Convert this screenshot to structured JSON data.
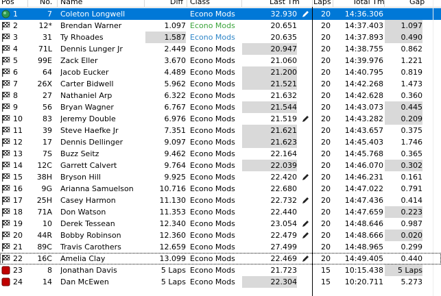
{
  "headers": {
    "pos": "Pos",
    "no": "No.",
    "name": "Name",
    "diff": "Diff",
    "class": "Class",
    "last_tm": "Last Tm",
    "laps": "Laps",
    "total_tm": "Total Tm",
    "gap": "Gap"
  },
  "colors": {
    "selected_bg": "#0078d7",
    "shade": "#d9d9d9",
    "green_text": "#3ba43b",
    "blue_text": "#2f86c8",
    "flag_green": "#2e9a52",
    "flag_stop": "#c00000"
  },
  "rows": [
    {
      "pos": "1",
      "no": "7",
      "name": "Coleton Longwell",
      "diff": "",
      "class": "Econo Mods",
      "last": "32.930",
      "laps": "20",
      "total": "14:36.306",
      "gap": "",
      "icon": "green-circle",
      "pencil": true,
      "selected": true
    },
    {
      "pos": "2",
      "no": "12*",
      "name": "Brendan Warner",
      "diff": "1.097",
      "class": "Econo Mods",
      "last": "20.651",
      "laps": "20",
      "total": "14:37.403",
      "gap": "1.097",
      "icon": "checkered-flag",
      "class_color": "green",
      "gap_shade": true
    },
    {
      "pos": "3",
      "no": "31",
      "name": "Ty Rhoades",
      "diff": "1.587",
      "class": "Econo Mods",
      "last": "20.635",
      "laps": "20",
      "total": "14:37.893",
      "gap": "0.490",
      "icon": "checkered-flag",
      "class_color": "blue",
      "diff_shade": true,
      "gap_shade": true
    },
    {
      "pos": "4",
      "no": "71L",
      "name": "Dennis Lunger Jr",
      "diff": "2.449",
      "class": "Econo Mods",
      "last": "20.947",
      "laps": "20",
      "total": "14:38.755",
      "gap": "0.862",
      "icon": "checkered-flag",
      "last_shade": true
    },
    {
      "pos": "5",
      "no": "99E",
      "name": "Zack Eller",
      "diff": "3.670",
      "class": "Econo Mods",
      "last": "21.060",
      "laps": "20",
      "total": "14:39.976",
      "gap": "1.221",
      "icon": "checkered-flag"
    },
    {
      "pos": "6",
      "no": "64",
      "name": "Jacob Eucker",
      "diff": "4.489",
      "class": "Econo Mods",
      "last": "21.200",
      "laps": "20",
      "total": "14:40.795",
      "gap": "0.819",
      "icon": "checkered-flag",
      "last_shade": true
    },
    {
      "pos": "7",
      "no": "26X",
      "name": "Carter Bidwell",
      "diff": "5.962",
      "class": "Econo Mods",
      "last": "21.521",
      "laps": "20",
      "total": "14:42.268",
      "gap": "1.473",
      "icon": "checkered-flag",
      "last_shade": true
    },
    {
      "pos": "8",
      "no": "27",
      "name": "Nathaniel Arp",
      "diff": "6.322",
      "class": "Econo Mods",
      "last": "21.632",
      "laps": "20",
      "total": "14:42.628",
      "gap": "0.360",
      "icon": "checkered-flag"
    },
    {
      "pos": "9",
      "no": "56",
      "name": "Bryan Wagner",
      "diff": "6.767",
      "class": "Econo Mods",
      "last": "21.544",
      "laps": "20",
      "total": "14:43.073",
      "gap": "0.445",
      "icon": "checkered-flag",
      "last_shade": true,
      "gap_shade": true
    },
    {
      "pos": "10",
      "no": "83",
      "name": "Jeremy Double",
      "diff": "6.976",
      "class": "Econo Mods",
      "last": "21.519",
      "laps": "20",
      "total": "14:43.282",
      "gap": "0.209",
      "icon": "checkered-flag",
      "pencil": true,
      "gap_shade": true
    },
    {
      "pos": "11",
      "no": "39",
      "name": "Steve Haefke Jr",
      "diff": "7.351",
      "class": "Econo Mods",
      "last": "21.621",
      "laps": "20",
      "total": "14:43.657",
      "gap": "0.375",
      "icon": "checkered-flag",
      "last_shade": true
    },
    {
      "pos": "12",
      "no": "17",
      "name": "Dennis Dellinger",
      "diff": "9.097",
      "class": "Econo Mods",
      "last": "21.623",
      "laps": "20",
      "total": "14:45.403",
      "gap": "1.746",
      "icon": "checkered-flag",
      "last_shade": true
    },
    {
      "pos": "13",
      "no": "7S",
      "name": "Buzz Seitz",
      "diff": "9.462",
      "class": "Econo Mods",
      "last": "22.164",
      "laps": "20",
      "total": "14:45.768",
      "gap": "0.365",
      "icon": "checkered-flag"
    },
    {
      "pos": "14",
      "no": "12C",
      "name": "Garrett Calvert",
      "diff": "9.764",
      "class": "Econo Mods",
      "last": "22.039",
      "laps": "20",
      "total": "14:46.070",
      "gap": "0.302",
      "icon": "checkered-flag",
      "last_shade": true,
      "gap_shade": true
    },
    {
      "pos": "15",
      "no": "38H",
      "name": "Bryson Hill",
      "diff": "9.925",
      "class": "Econo Mods",
      "last": "22.420",
      "laps": "20",
      "total": "14:46.231",
      "gap": "0.161",
      "icon": "checkered-flag",
      "pencil": true
    },
    {
      "pos": "16",
      "no": "9G",
      "name": "Arianna Samuelson",
      "diff": "10.716",
      "class": "Econo Mods",
      "last": "22.680",
      "laps": "20",
      "total": "14:47.022",
      "gap": "0.791",
      "icon": "checkered-flag"
    },
    {
      "pos": "17",
      "no": "25H",
      "name": "Casey Harmon",
      "diff": "11.130",
      "class": "Econo Mods",
      "last": "22.732",
      "laps": "20",
      "total": "14:47.436",
      "gap": "0.414",
      "icon": "checkered-flag",
      "pencil": true
    },
    {
      "pos": "18",
      "no": "71A",
      "name": "Don Watson",
      "diff": "11.353",
      "class": "Econo Mods",
      "last": "22.440",
      "laps": "20",
      "total": "14:47.659",
      "gap": "0.223",
      "icon": "checkered-flag",
      "gap_shade": true
    },
    {
      "pos": "19",
      "no": "10",
      "name": "Derek Tessean",
      "diff": "12.340",
      "class": "Econo Mods",
      "last": "23.054",
      "laps": "20",
      "total": "14:48.646",
      "gap": "0.987",
      "icon": "checkered-flag",
      "pencil": true
    },
    {
      "pos": "20",
      "no": "44R",
      "name": "Bobby Robinson",
      "diff": "12.360",
      "class": "Econo Mods",
      "last": "22.479",
      "laps": "20",
      "total": "14:48.666",
      "gap": "0.020",
      "icon": "checkered-flag",
      "pencil": true,
      "gap_shade": true
    },
    {
      "pos": "21",
      "no": "89C",
      "name": "Travis Carothers",
      "diff": "12.659",
      "class": "Econo Mods",
      "last": "27.499",
      "laps": "20",
      "total": "14:48.965",
      "gap": "0.299",
      "icon": "checkered-flag"
    },
    {
      "pos": "22",
      "no": "16C",
      "name": "Amelia Clay",
      "diff": "13.099",
      "class": "Econo Mods",
      "last": "22.469",
      "laps": "20",
      "total": "14:49.405",
      "gap": "0.440",
      "icon": "checkered-flag",
      "pencil": true,
      "focus": true
    },
    {
      "pos": "23",
      "no": "8",
      "name": "Jonathan Davis",
      "diff": "5 Laps",
      "class": "Econo Mods",
      "last": "21.723",
      "laps": "15",
      "total": "10:15.438",
      "gap": "5 Laps",
      "icon": "red-square",
      "gap_shade": true
    },
    {
      "pos": "24",
      "no": "14",
      "name": "Dan McEwen",
      "diff": "5 Laps",
      "class": "Econo Mods",
      "last": "22.304",
      "laps": "15",
      "total": "10:20.711",
      "gap": "5.273",
      "icon": "red-square",
      "last_shade": true
    }
  ]
}
